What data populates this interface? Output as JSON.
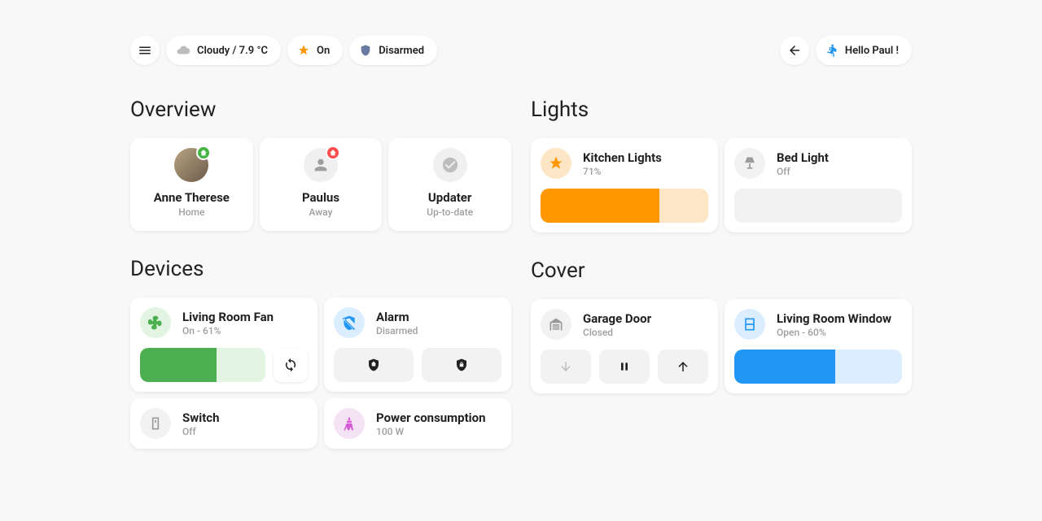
{
  "header": {
    "weather_label": "Cloudy / 7.9 °C",
    "lights_chip": "On",
    "alarm_chip": "Disarmed",
    "greeting": "Hello Paul !"
  },
  "overview": {
    "title": "Overview",
    "items": [
      {
        "name": "Anne Therese",
        "status": "Home"
      },
      {
        "name": "Paulus",
        "status": "Away"
      },
      {
        "name": "Updater",
        "status": "Up-to-date"
      }
    ]
  },
  "lights": {
    "title": "Lights",
    "items": [
      {
        "name": "Kitchen Lights",
        "status": "71%",
        "percent": 71,
        "on": true
      },
      {
        "name": "Bed Light",
        "status": "Off",
        "percent": 0,
        "on": false
      }
    ]
  },
  "devices": {
    "title": "Devices",
    "fan": {
      "name": "Living Room Fan",
      "status": "On - 61%",
      "percent": 61
    },
    "alarm": {
      "name": "Alarm",
      "status": "Disarmed"
    },
    "switch": {
      "name": "Switch",
      "status": "Off"
    },
    "power": {
      "name": "Power consumption",
      "status": "100 W"
    }
  },
  "cover": {
    "title": "Cover",
    "garage": {
      "name": "Garage Door",
      "status": "Closed"
    },
    "window": {
      "name": "Living Room Window",
      "status": "Open - 60%",
      "percent": 60
    }
  }
}
